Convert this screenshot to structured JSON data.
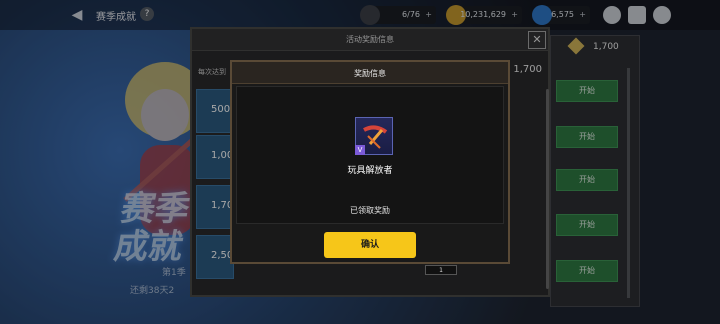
{
  "topbar": {
    "back_label": "◀",
    "title": "赛季成就",
    "help_label": "?",
    "resources": [
      {
        "name": "stamina",
        "value": "6/76",
        "plus": "+",
        "color": "#3d4048"
      },
      {
        "name": "gold",
        "value": "10,231,629",
        "plus": "+",
        "color": "#c79a2f"
      },
      {
        "name": "gem",
        "value": "6,575",
        "plus": "+",
        "color": "#2f79c9"
      }
    ]
  },
  "background": {
    "title": "赛季\n成就",
    "rank": "第1季",
    "timer": "还剩38天2"
  },
  "panel": {
    "title": "活动奖励信息",
    "close": "✕",
    "row_label": "每次达到",
    "row_value": "1,700",
    "tiers": [
      "500",
      "1,00",
      "1,70",
      "2,50"
    ]
  },
  "right_list": {
    "value": "1,700",
    "buttons": [
      "开始",
      "开始",
      "开始",
      "开始",
      "开始"
    ]
  },
  "modal": {
    "title": "奖励信息",
    "item_name": "玩具解放者",
    "item_badge": "V",
    "status": "已领取奖励",
    "confirm": "确认",
    "tag": "1"
  },
  "colors": {
    "confirm": "#f6c619",
    "start": "#2f7a43",
    "item_frame": "#5b64b3"
  }
}
